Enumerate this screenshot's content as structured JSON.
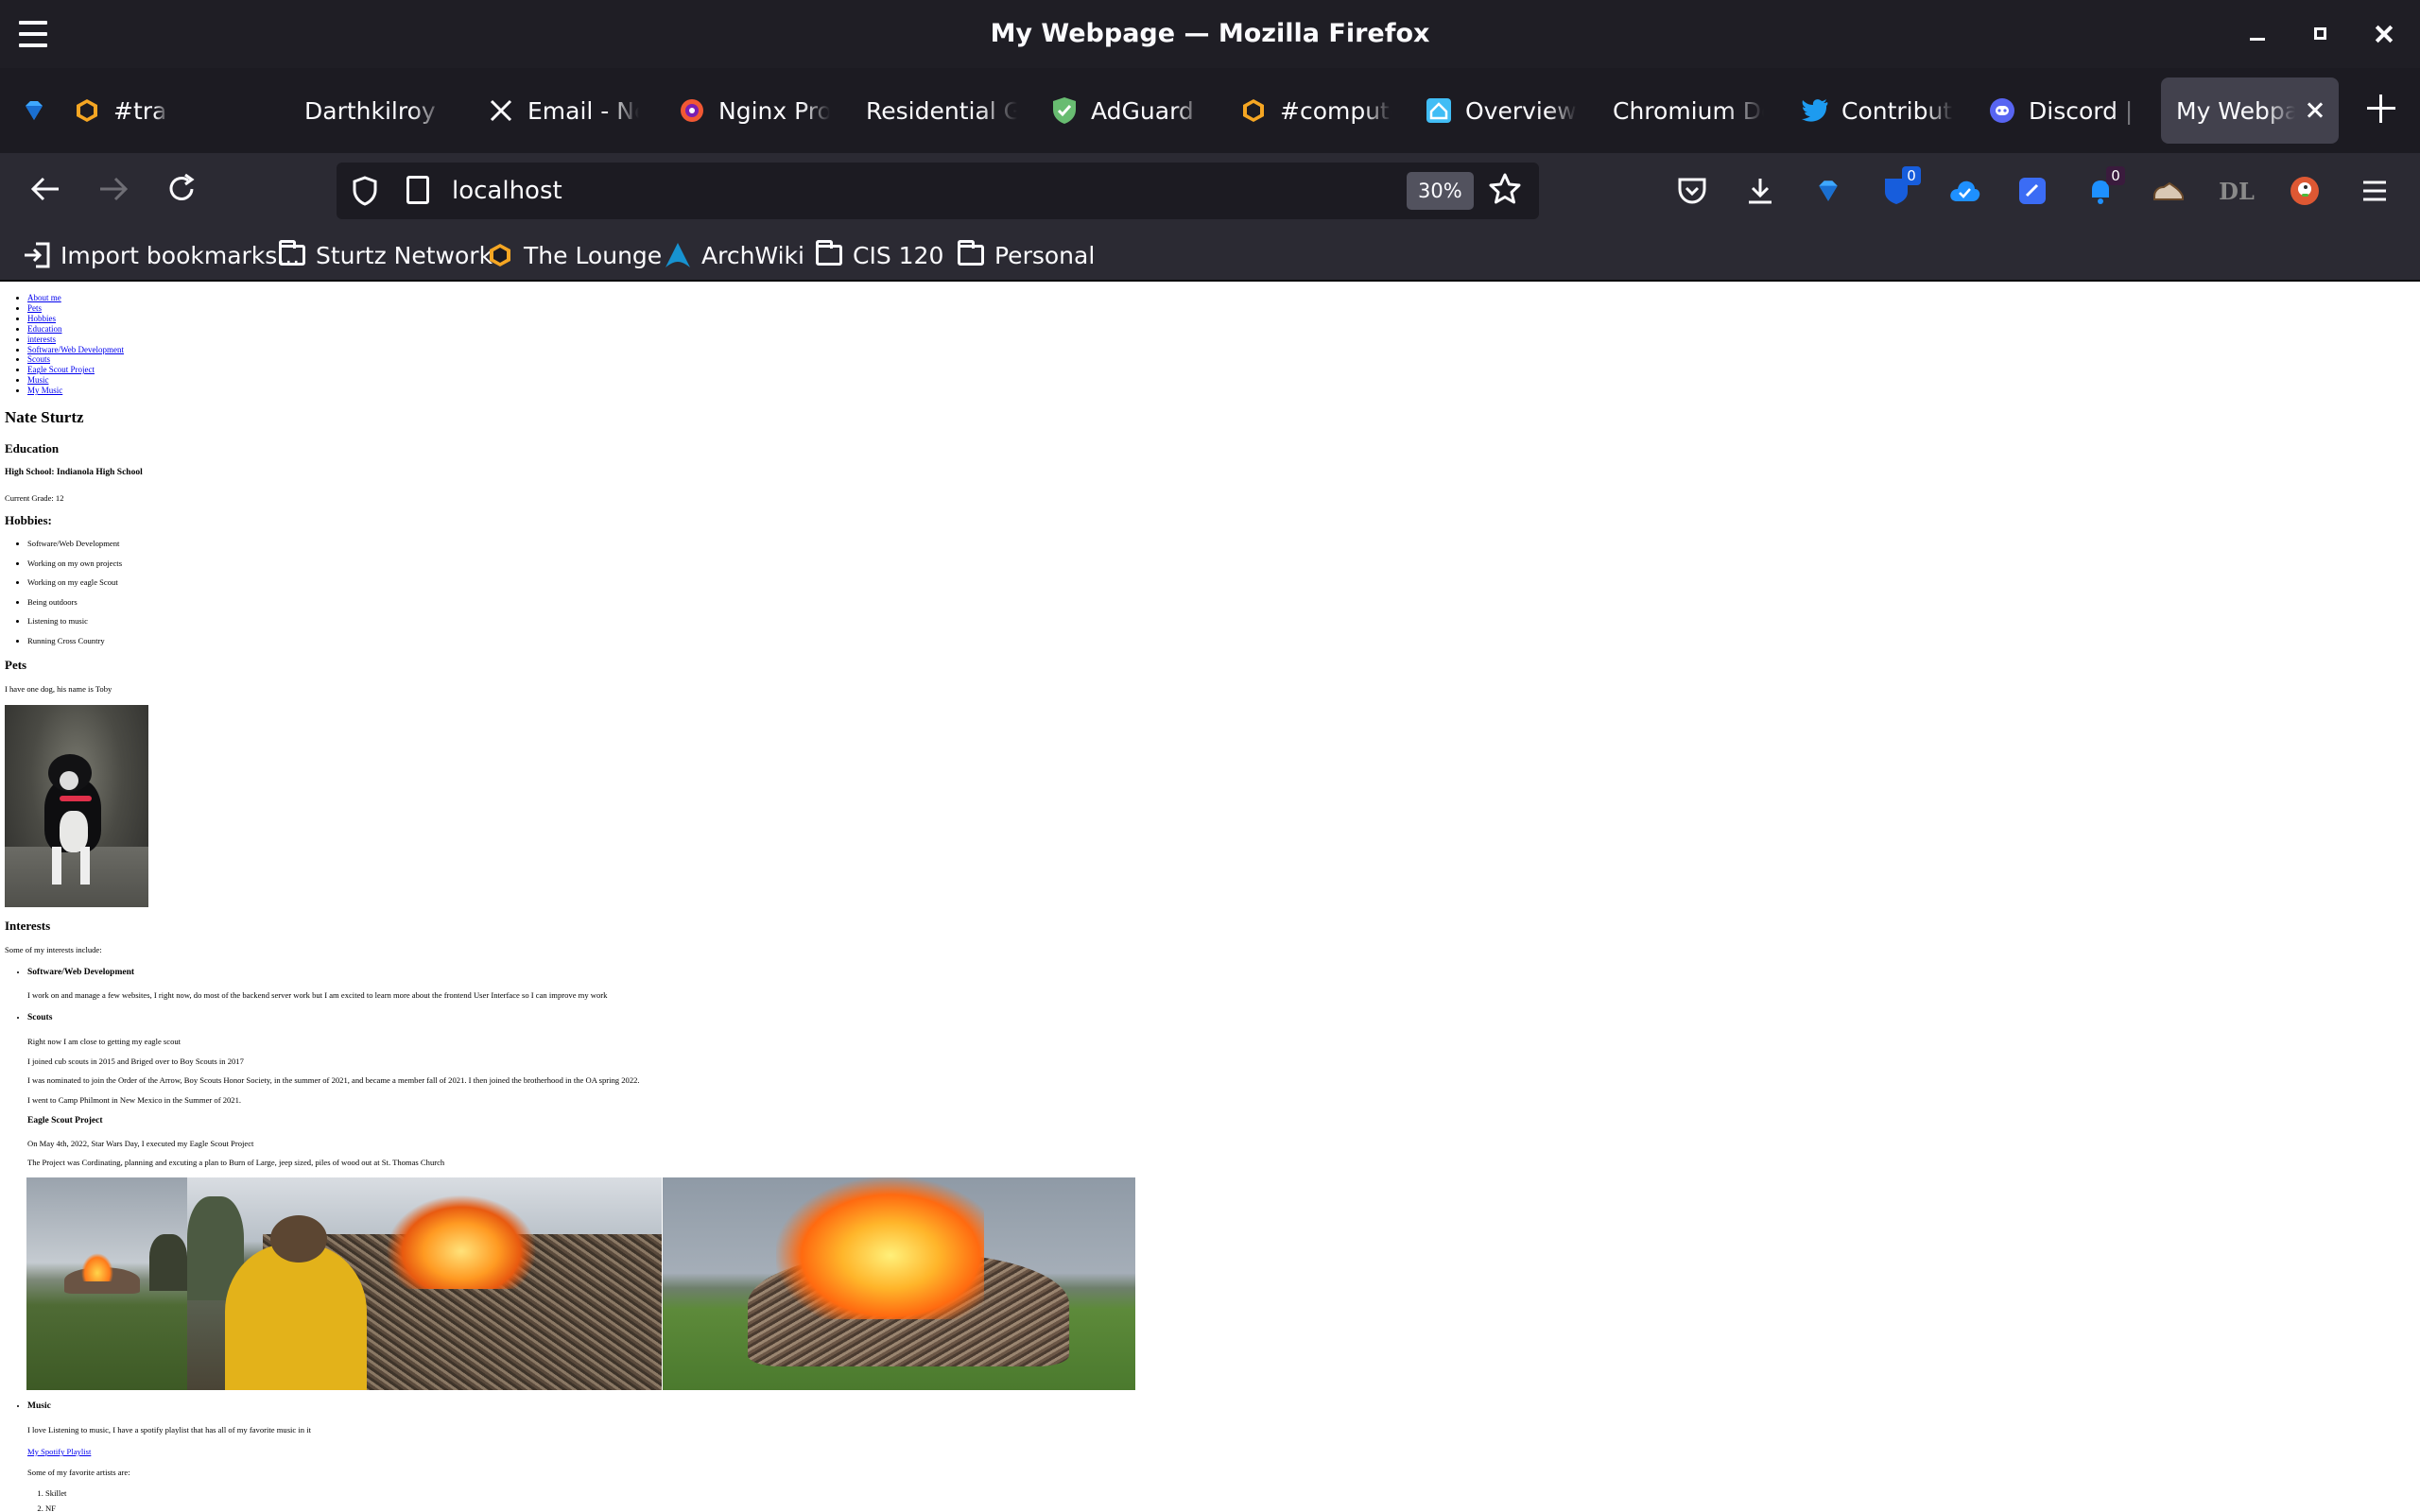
{
  "window": {
    "title": "My Webpage — Mozilla Firefox"
  },
  "tabs": [
    {
      "label": "#transienc",
      "icon": "hexagon-icon"
    },
    {
      "label": "Darthkilroy | W",
      "icon": ""
    },
    {
      "label": "Email - Ne",
      "icon": "x-logo-icon"
    },
    {
      "label": "Nginx Prox",
      "icon": "nginx-proxy-icon"
    },
    {
      "label": "Residential Ga",
      "icon": ""
    },
    {
      "label": "AdGuard H",
      "icon": "adguard-shield-icon"
    },
    {
      "label": "#computer",
      "icon": "hexagon-icon"
    },
    {
      "label": "Overview -",
      "icon": "home-assistant-icon"
    },
    {
      "label": "Chromium Doc",
      "icon": ""
    },
    {
      "label": "Contributor",
      "icon": "twitter-icon"
    },
    {
      "label": "Discord | #",
      "icon": "discord-icon"
    },
    {
      "label": "My Webpag",
      "icon": "",
      "active": true
    }
  ],
  "toolbar": {
    "url": "localhost",
    "zoom": "30%",
    "badge_count_1": "0",
    "badge_count_2": "0"
  },
  "bookmarks": [
    {
      "label": "Import bookmarks...",
      "icon": "import-icon"
    },
    {
      "label": "Sturtz Network",
      "icon": "folder-icon"
    },
    {
      "label": "The Lounge",
      "icon": "hexagon-icon"
    },
    {
      "label": "ArchWiki",
      "icon": "arch-linux-icon"
    },
    {
      "label": "CIS 120",
      "icon": "folder-icon"
    },
    {
      "label": "Personal",
      "icon": "folder-icon"
    }
  ],
  "page": {
    "nav": [
      "About me",
      "Pets",
      "Hobbies",
      "Education",
      "interests",
      "Software/Web Development",
      "Scouts",
      "Eagle Scout Project",
      "Music",
      "My Music"
    ],
    "name": "Nate Sturtz",
    "education": {
      "heading": "Education",
      "school": "High School: Indianola High School",
      "grade": "Current Grade: 12"
    },
    "hobbies": {
      "heading": "Hobbies:",
      "items": [
        "Software/Web Development",
        "Working on my own projects",
        "Working on my eagle Scout",
        "Being outdoors",
        "Listening to music",
        "Running Cross Country"
      ]
    },
    "pets": {
      "heading": "Pets",
      "text": "I have one dog, his name is Toby"
    },
    "interests": {
      "heading": "Interests",
      "intro": "Some of my interests include:",
      "software_heading": "Software/Web Development",
      "software_text": "I work on and manage a few websites, I right now, do most of the backend server work but I am excited to learn more about the frontend User Interface so I can improve my work",
      "scouts_heading": "Scouts",
      "scouts_lines": [
        "Right now I am close to getting my eagle scout",
        "I joined cub scouts in 2015 and Briged over to Boy Scouts in 2017",
        "I was nominated to join the Order of the Arrow, Boy Scouts Honor Society, in the summer of 2021, and became a member fall of 2021. I then joined the brotherhood in the OA spring 2022.",
        "I went to Camp Philmont in New Mexico in the Summer of 2021."
      ],
      "eagle_heading": "Eagle Scout Project",
      "eagle_lines": [
        "On May 4th, 2022, Star Wars Day, I executed my Eagle Scout Project",
        "The Project was Cordinating, planning and excuting a plan to Burn of Large, jeep sized, piles of wood out at St. Thomas Church"
      ],
      "music_heading": "Music",
      "music_text": "I love Listening to music, I have a spotify playlist that has all of my favorite music in it",
      "playlist_link": "My Spotify Playlist",
      "artists_intro": "Some of my favorite artists are:",
      "artists": [
        "Skillet",
        "NF"
      ]
    }
  }
}
